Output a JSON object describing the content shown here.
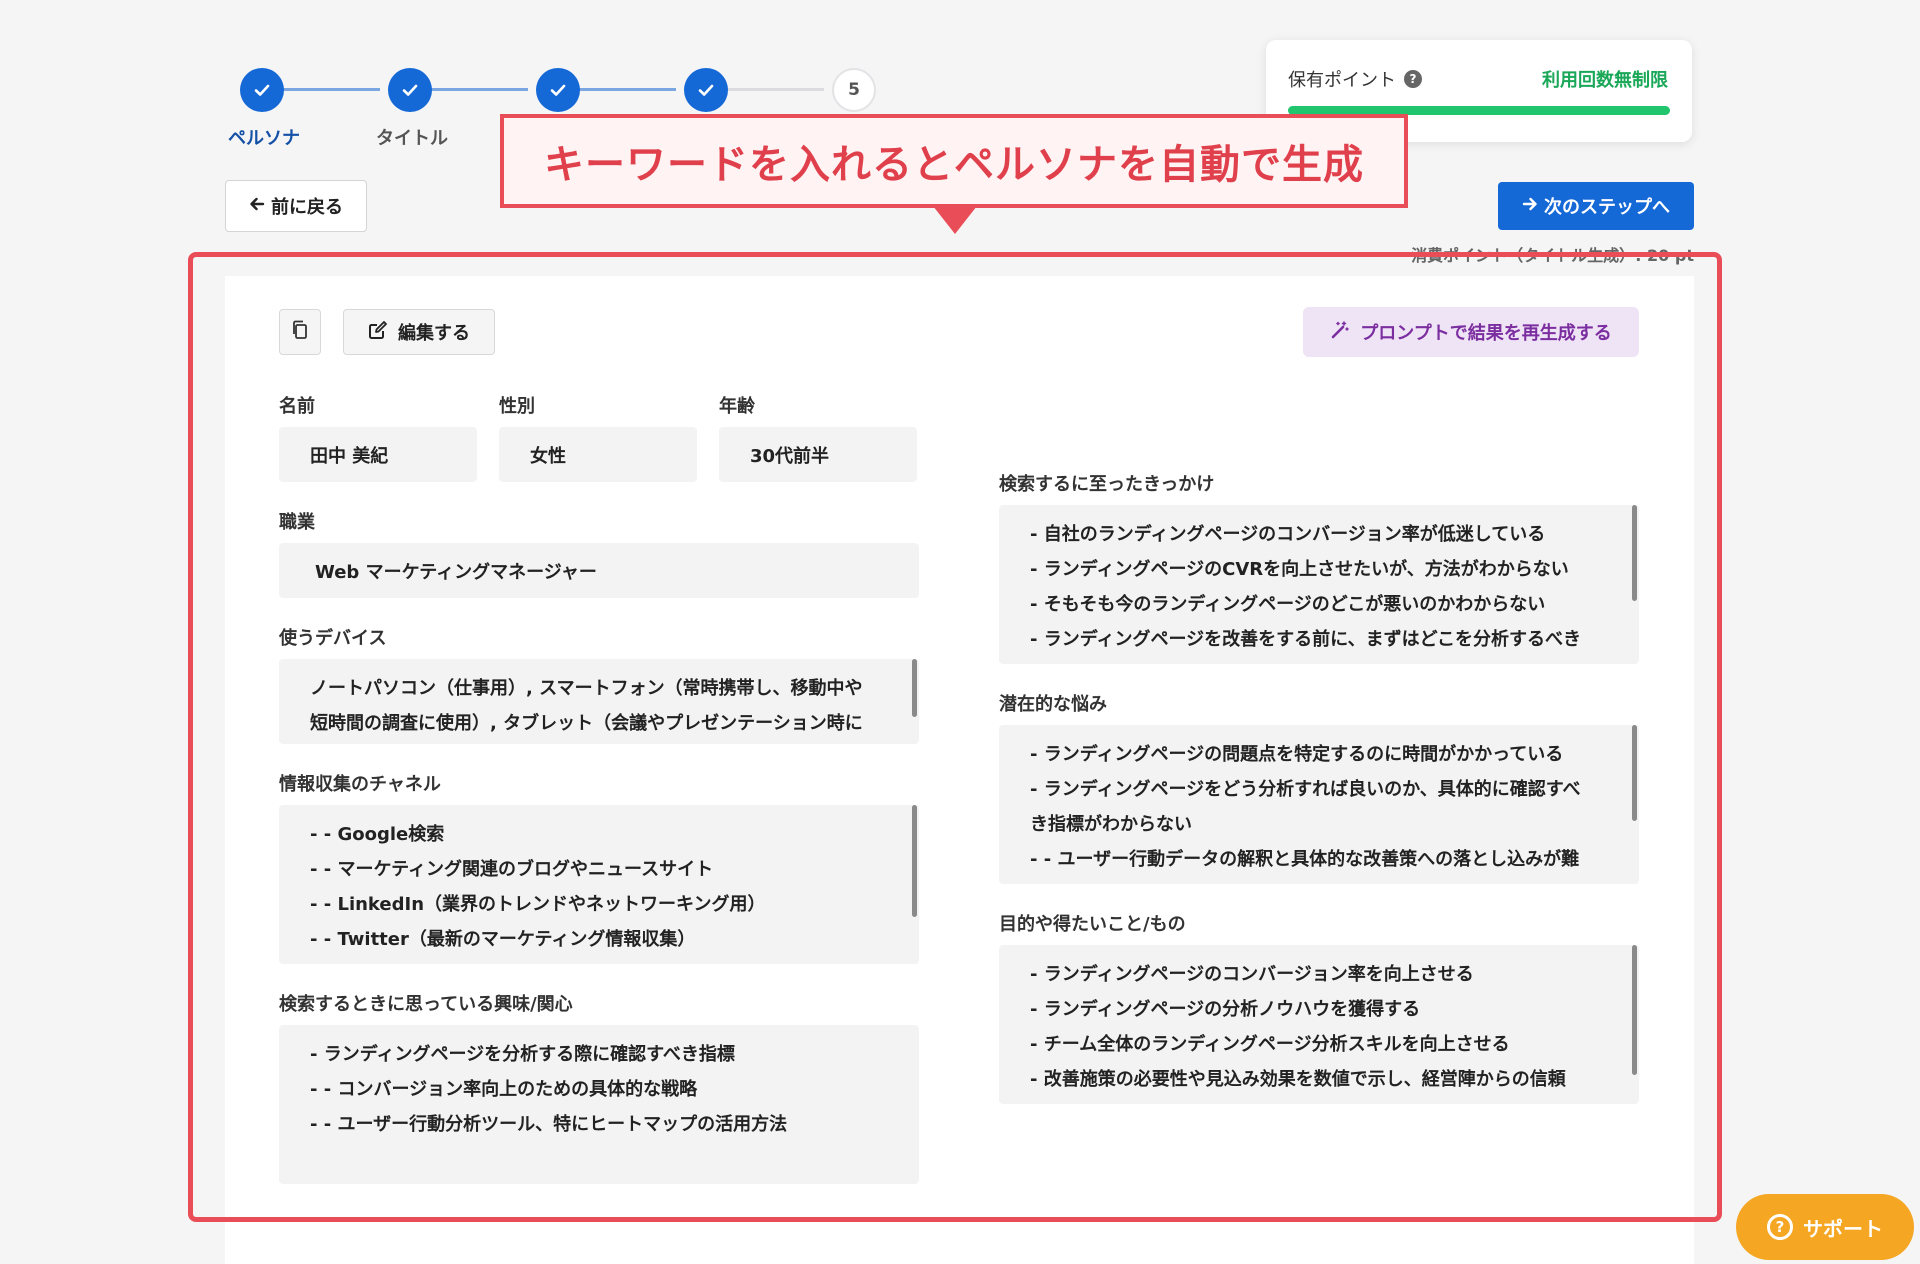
{
  "stepper": {
    "steps": [
      {
        "label": "ペルソナ",
        "status": "done"
      },
      {
        "label": "タイトル",
        "status": "done"
      },
      {
        "label": "",
        "status": "done"
      },
      {
        "label": "",
        "status": "done"
      },
      {
        "label": "",
        "number": "5",
        "status": "pending"
      }
    ]
  },
  "points": {
    "label": "保有ポイント",
    "help_icon": "question-circle-icon",
    "status": "利用回数無制限",
    "bar_fill_fraction": 1.0,
    "bar_color": "#21c56d"
  },
  "nav": {
    "back_label": "前に戻る",
    "next_label": "次のステップへ",
    "consume_note": "消費ポイント（タイトル生成）: 20 pt"
  },
  "callout": {
    "text": "キーワードを入れるとペルソナを自動で生成"
  },
  "toolbar": {
    "copy_icon": "copy-icon",
    "edit_label": "編集する",
    "regenerate_label": "プロンプトで結果を再生成する"
  },
  "persona": {
    "name_label": "名前",
    "name_value": "田中 美紀",
    "gender_label": "性別",
    "gender_value": "女性",
    "age_label": "年齢",
    "age_value": "30代前半",
    "job_label": "職業",
    "job_value": "Web マーケティングマネージャー",
    "devices_label": "使うデバイス",
    "devices_lines": [
      "ノートパソコン（仕事用）, スマートフォン（常時携帯し、移動中や",
      "短時間の調査に使用）, タブレット（会議やプレゼンテーション時に"
    ],
    "channels_label": "情報収集のチャネル",
    "channels_lines": [
      "- - Google検索",
      "- - マーケティング関連のブログやニュースサイト",
      "- - LinkedIn（業界のトレンドやネットワーキング用）",
      "- - Twitter（最新のマーケティング情報収集）"
    ],
    "interests_label": "検索するときに思っている興味/関心",
    "interests_lines": [
      "- ランディングページを分析する際に確認すべき指標",
      "- - コンバージョン率向上のための具体的な戦略",
      "- - ユーザー行動分析ツール、特にヒートマップの活用方法"
    ],
    "trigger_label": "検索するに至ったきっかけ",
    "trigger_lines": [
      "- 自社のランディングページのコンバージョン率が低迷している",
      "- ランディングページのCVRを向上させたいが、方法がわからない",
      "- そもそも今のランディングページのどこが悪いのかわからない",
      "- ランディングページを改善をする前に、まずはどこを分析するべき"
    ],
    "pain_label": "潜在的な悩み",
    "pain_lines": [
      "- ランディングページの問題点を特定するのに時間がかかっている",
      "- ランディングページをどう分析すれば良いのか、具体的に確認すべ",
      "き指標がわからない",
      "- - ユーザー行動データの解釈と具体的な改善策への落とし込みが難"
    ],
    "goal_label": "目的や得たいこと/もの",
    "goal_lines": [
      "- ランディングページのコンバージョン率を向上させる",
      "- ランディングページの分析ノウハウを獲得する",
      "- チーム全体のランディングページ分析スキルを向上させる",
      "- 改善施策の必要性や見込み効果を数値で示し、経営陣からの信頼"
    ]
  },
  "support": {
    "label": "サポート",
    "icon": "question-circle-icon"
  },
  "colors": {
    "primary": "#1569d7",
    "accent_red": "#e94d57",
    "success_green": "#21c56d",
    "support_orange": "#f5a623",
    "regen_purple": "#7b2ea0"
  }
}
